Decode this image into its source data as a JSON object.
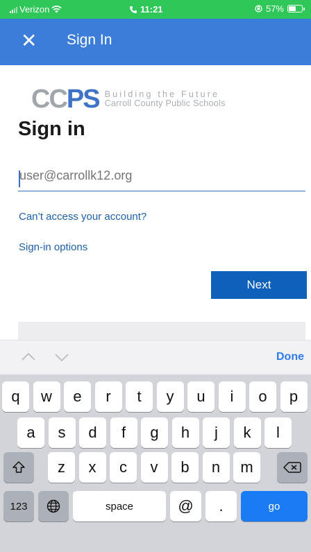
{
  "status_bar": {
    "carrier": "Verizon",
    "time": "11:21",
    "battery": "57%",
    "battery_level": 0.57
  },
  "nav": {
    "close_icon": "close-icon",
    "title": "Sign In"
  },
  "logo": {
    "mark": "CC",
    "mark_globe": "PS",
    "tagline_1": "Building the Future",
    "tagline_2": "Carroll County Public Schools"
  },
  "signin": {
    "heading": "Sign in",
    "email_placeholder": "user@carrollk12.org",
    "email_value": "",
    "cant_access": "Can’t access your account?",
    "signin_options": "Sign-in options",
    "next_label": "Next"
  },
  "keyboard": {
    "done_label": "Done",
    "row1": [
      "q",
      "w",
      "e",
      "r",
      "t",
      "y",
      "u",
      "i",
      "o",
      "p"
    ],
    "row2": [
      "a",
      "s",
      "d",
      "f",
      "g",
      "h",
      "j",
      "k",
      "l"
    ],
    "row3": [
      "z",
      "x",
      "c",
      "v",
      "b",
      "n",
      "m"
    ],
    "numbers_label": "123",
    "space_label": "space",
    "at_label": "@",
    "dot_label": ".",
    "go_label": "go"
  }
}
